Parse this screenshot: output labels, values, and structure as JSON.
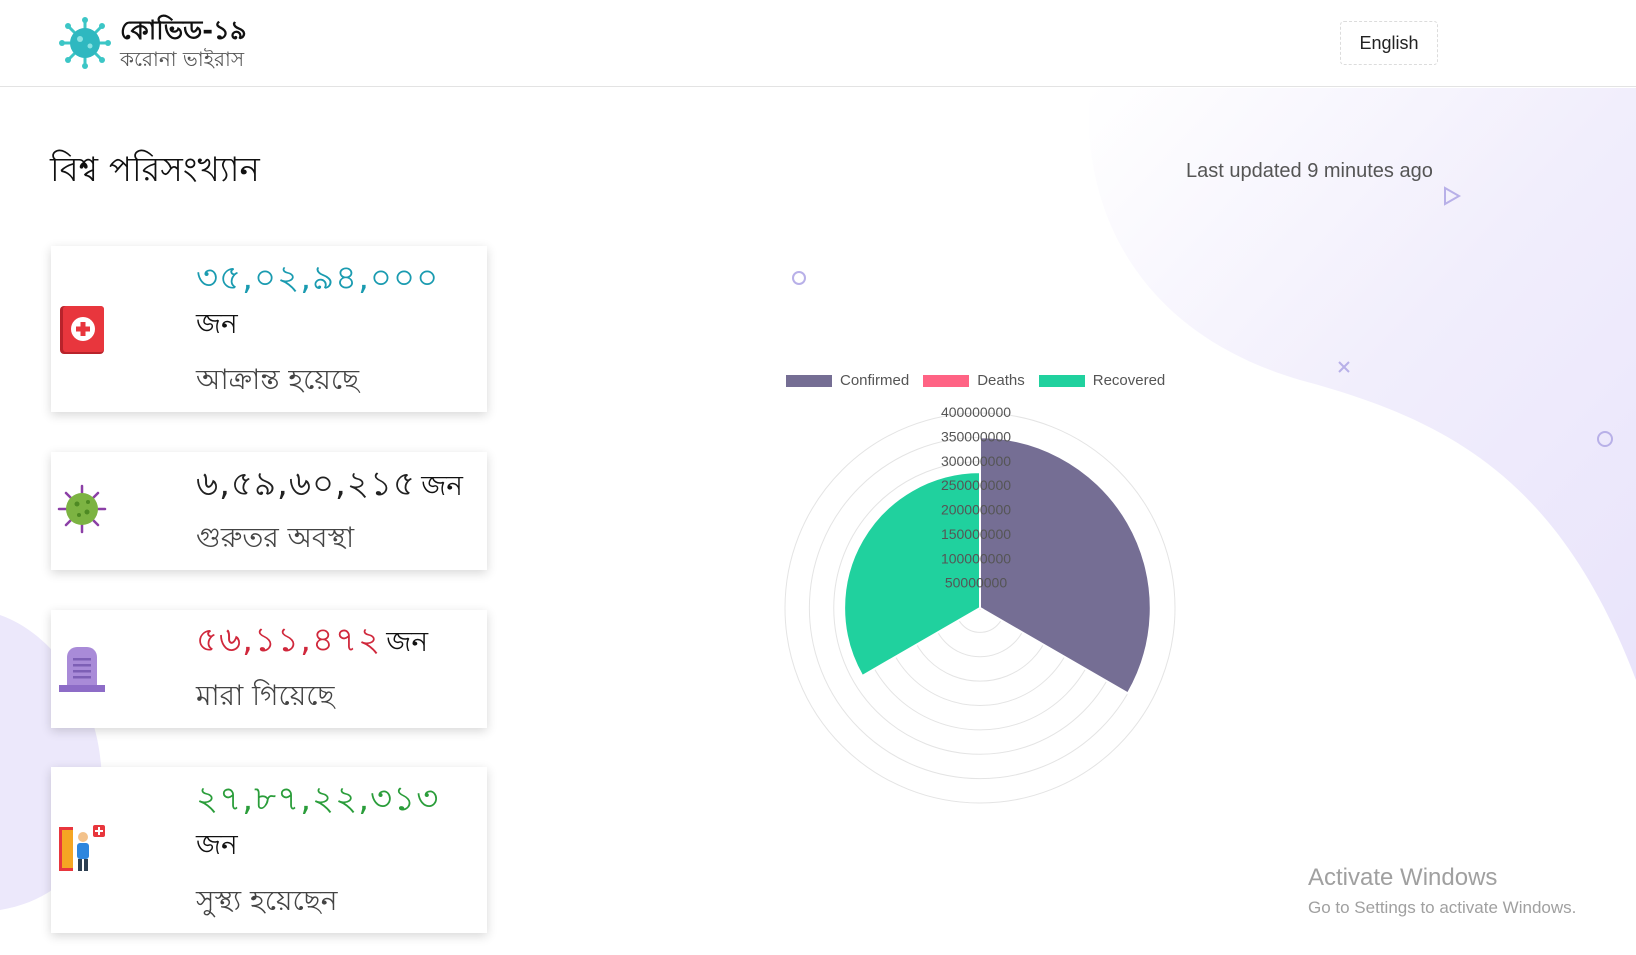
{
  "header": {
    "title": "কোভিড-১৯",
    "subtitle": "করোনা ভাইরাস",
    "language_button": "English",
    "logo_icon": "virus-icon"
  },
  "main": {
    "title": "বিশ্ব পরিসংখ্যান",
    "last_updated": "Last updated 9 minutes ago"
  },
  "cards": [
    {
      "number": "৩৫,০২,৯৪,০০০",
      "unit": "জন",
      "label": "আক্রান্ত হয়েছে",
      "color": "#1a9bb0",
      "icon": "first-aid-kit-icon"
    },
    {
      "number": "৬,৫৯,৬০,২১৫",
      "unit": "জন",
      "label": "গুরুতর অবস্থা",
      "color": "#222222",
      "icon": "virus-icon"
    },
    {
      "number": "৫৬,১১,৪৭২",
      "unit": "জন",
      "label": "মারা গিয়েছে",
      "color": "#d0283c",
      "icon": "tombstone-icon"
    },
    {
      "number": "২৭,৮৭,২২,৩১৩",
      "unit": "জন",
      "label": "সুস্থ্য হয়েছেন",
      "color": "#2a9d3a",
      "icon": "hospital-exit-icon"
    }
  ],
  "chart_data": {
    "type": "polar-area",
    "categories": [
      "Confirmed",
      "Deaths",
      "Recovered"
    ],
    "values": [
      350294000,
      5611472,
      278722313
    ],
    "colors": [
      "#756e94",
      "#ff6384",
      "#20d19e"
    ],
    "legend": "top",
    "r_ticks": [
      "400000000",
      "350000000",
      "300000000",
      "250000000",
      "200000000",
      "150000000",
      "100000000",
      "50000000"
    ],
    "rmax": 400000000
  },
  "watermark": {
    "title": "Activate Windows",
    "subtitle": "Go to Settings to activate Windows."
  }
}
